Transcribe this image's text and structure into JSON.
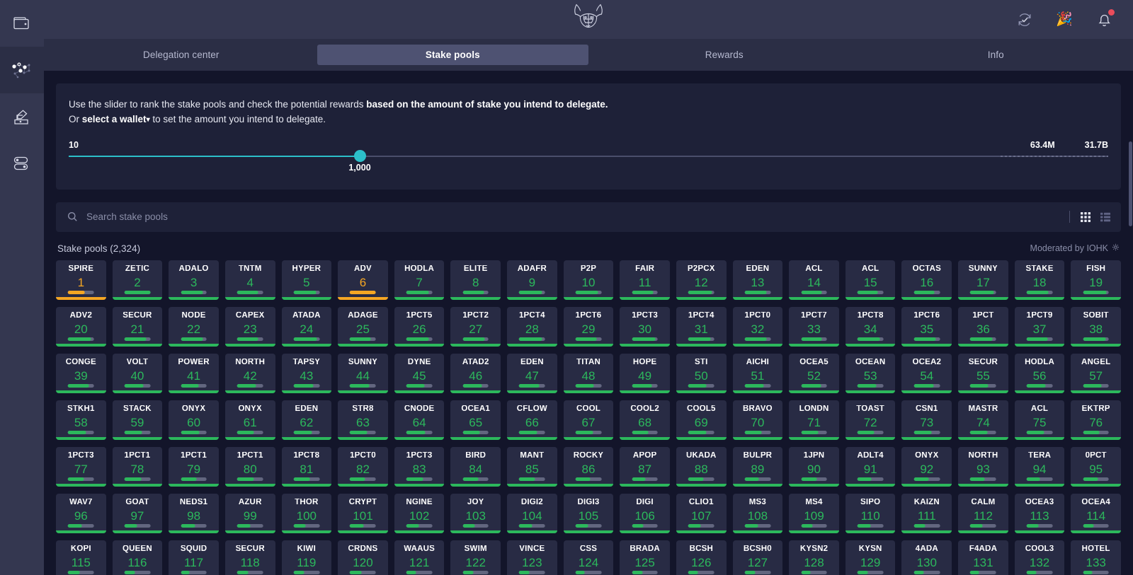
{
  "sidebar": {
    "items": [
      {
        "name": "wallet",
        "icon": "wallet-icon",
        "selected": false
      },
      {
        "name": "delegation",
        "icon": "network-nodes-icon",
        "selected": true
      },
      {
        "name": "voting",
        "icon": "ballot-box-icon",
        "selected": false
      },
      {
        "name": "settings",
        "icon": "toggles-icon",
        "selected": false
      }
    ]
  },
  "topbar": {
    "logo": "bull-head-logo",
    "icons": [
      {
        "name": "sync-status-icon",
        "glyph": "check-circle-arrows"
      },
      {
        "name": "celebration-icon",
        "glyph": "🎉"
      },
      {
        "name": "notifications-bell-icon",
        "glyph": "bell",
        "badge": true
      }
    ]
  },
  "tabs": [
    {
      "label": "Delegation center",
      "active": false
    },
    {
      "label": "Stake pools",
      "active": true
    },
    {
      "label": "Rewards",
      "active": false
    },
    {
      "label": "Info",
      "active": false
    }
  ],
  "slider_card": {
    "line1_pre": "Use the slider to rank the stake pools and check the potential rewards ",
    "line1_bold": "based on the amount of stake you intend to delegate.",
    "line2_pre": "Or ",
    "line2_link": "select a wallet",
    "line2_caret": "⌄",
    "line2_post": " to set the amount you intend to delegate.",
    "min_label": "10",
    "value_label": "1,000",
    "mid_label": "63.4M",
    "max_label": "31.7B",
    "fill_percent": 28
  },
  "search": {
    "placeholder": "Search stake pools",
    "value": "",
    "icon": "search-icon",
    "grid_view_icon": "grid-view-icon",
    "list_view_icon": "list-view-icon",
    "active_view": "grid"
  },
  "pools_header": {
    "title": "Stake pools (2,324)",
    "moderated": "Moderated by IOHK",
    "moderated_icon": "gear-icon"
  },
  "colors": {
    "rank_green": "#2cb85c",
    "rank_orange": "#f5a623",
    "slider_accent": "#2cbfc9",
    "badge_red": "#ea4c5b",
    "tile_bg": "#282b44",
    "card_bg": "#1e2138",
    "page_bg": "#13152a",
    "chrome_bg": "#343750"
  },
  "pools": [
    {
      "ticker": "SPIRE",
      "rank": 1,
      "status": "warn",
      "sat": 64
    },
    {
      "ticker": "ZETIC",
      "rank": 2,
      "status": "ok",
      "sat": 100
    },
    {
      "ticker": "ADALO",
      "rank": 3,
      "status": "ok",
      "sat": 86
    },
    {
      "ticker": "TNTM",
      "rank": 4,
      "status": "ok",
      "sat": 82
    },
    {
      "ticker": "HYPER",
      "rank": 5,
      "status": "ok",
      "sat": 88
    },
    {
      "ticker": "ADV",
      "rank": 6,
      "status": "warn",
      "sat": 100
    },
    {
      "ticker": "HODLA",
      "rank": 7,
      "status": "ok",
      "sat": 88
    },
    {
      "ticker": "ELITE",
      "rank": 8,
      "status": "ok",
      "sat": 82
    },
    {
      "ticker": "ADAFR",
      "rank": 9,
      "status": "ok",
      "sat": 90
    },
    {
      "ticker": "P2P",
      "rank": 10,
      "status": "ok",
      "sat": 86
    },
    {
      "ticker": "FAIR",
      "rank": 11,
      "status": "ok",
      "sat": 84
    },
    {
      "ticker": "P2PCX",
      "rank": 12,
      "status": "ok",
      "sat": 92
    },
    {
      "ticker": "EDEN",
      "rank": 13,
      "status": "ok",
      "sat": 84
    },
    {
      "ticker": "ACL",
      "rank": 14,
      "status": "ok",
      "sat": 80
    },
    {
      "ticker": "ACL",
      "rank": 15,
      "status": "ok",
      "sat": 78
    },
    {
      "ticker": "OCTAS",
      "rank": 16,
      "status": "ok",
      "sat": 80
    },
    {
      "ticker": "SUNNY",
      "rank": 17,
      "status": "ok",
      "sat": 92
    },
    {
      "ticker": "STAKE",
      "rank": 18,
      "status": "ok",
      "sat": 84
    },
    {
      "ticker": "FISH",
      "rank": 19,
      "status": "ok",
      "sat": 90
    },
    {
      "ticker": "ADV2",
      "rank": 20,
      "status": "ok",
      "sat": 88
    },
    {
      "ticker": "SECUR",
      "rank": 21,
      "status": "ok",
      "sat": 84
    },
    {
      "ticker": "NODE",
      "rank": 22,
      "status": "ok",
      "sat": 86
    },
    {
      "ticker": "CAPEX",
      "rank": 23,
      "status": "ok",
      "sat": 82
    },
    {
      "ticker": "ATADA",
      "rank": 24,
      "status": "ok",
      "sat": 90
    },
    {
      "ticker": "ADAGE",
      "rank": 25,
      "status": "ok",
      "sat": 80
    },
    {
      "ticker": "1PCT5",
      "rank": 26,
      "status": "ok",
      "sat": 86
    },
    {
      "ticker": "1PCT2",
      "rank": 27,
      "status": "ok",
      "sat": 84
    },
    {
      "ticker": "1PCT4",
      "rank": 28,
      "status": "ok",
      "sat": 88
    },
    {
      "ticker": "1PCT6",
      "rank": 29,
      "status": "ok",
      "sat": 82
    },
    {
      "ticker": "1PCT3",
      "rank": 30,
      "status": "ok",
      "sat": 90
    },
    {
      "ticker": "1PCT4",
      "rank": 31,
      "status": "ok",
      "sat": 86
    },
    {
      "ticker": "1PCT0",
      "rank": 32,
      "status": "ok",
      "sat": 84
    },
    {
      "ticker": "1PCT7",
      "rank": 33,
      "status": "ok",
      "sat": 80
    },
    {
      "ticker": "1PCT8",
      "rank": 34,
      "status": "ok",
      "sat": 88
    },
    {
      "ticker": "1PCT6",
      "rank": 35,
      "status": "ok",
      "sat": 84
    },
    {
      "ticker": "1PCT",
      "rank": 36,
      "status": "ok",
      "sat": 86
    },
    {
      "ticker": "1PCT9",
      "rank": 37,
      "status": "ok",
      "sat": 82
    },
    {
      "ticker": "SOBIT",
      "rank": 38,
      "status": "ok",
      "sat": 88
    },
    {
      "ticker": "CONGE",
      "rank": 39,
      "status": "ok",
      "sat": 80
    },
    {
      "ticker": "VOLT",
      "rank": 40,
      "status": "ok",
      "sat": 74
    },
    {
      "ticker": "POWER",
      "rank": 41,
      "status": "ok",
      "sat": 68
    },
    {
      "ticker": "NORTH",
      "rank": 42,
      "status": "ok",
      "sat": 72
    },
    {
      "ticker": "TAPSY",
      "rank": 43,
      "status": "ok",
      "sat": 78
    },
    {
      "ticker": "SUNNY",
      "rank": 44,
      "status": "ok",
      "sat": 76
    },
    {
      "ticker": "DYNE",
      "rank": 45,
      "status": "ok",
      "sat": 70
    },
    {
      "ticker": "ATAD2",
      "rank": 46,
      "status": "ok",
      "sat": 74
    },
    {
      "ticker": "EDEN",
      "rank": 47,
      "status": "ok",
      "sat": 78
    },
    {
      "ticker": "TITAN",
      "rank": 48,
      "status": "ok",
      "sat": 72
    },
    {
      "ticker": "HOPE",
      "rank": 49,
      "status": "ok",
      "sat": 76
    },
    {
      "ticker": "STI",
      "rank": 50,
      "status": "ok",
      "sat": 70
    },
    {
      "ticker": "AICHI",
      "rank": 51,
      "status": "ok",
      "sat": 74
    },
    {
      "ticker": "OCEA5",
      "rank": 52,
      "status": "ok",
      "sat": 78
    },
    {
      "ticker": "OCEAN",
      "rank": 53,
      "status": "ok",
      "sat": 72
    },
    {
      "ticker": "OCEA2",
      "rank": 54,
      "status": "ok",
      "sat": 76
    },
    {
      "ticker": "SECUR",
      "rank": 55,
      "status": "ok",
      "sat": 70
    },
    {
      "ticker": "HODLA",
      "rank": 56,
      "status": "ok",
      "sat": 74
    },
    {
      "ticker": "ANGEL",
      "rank": 57,
      "status": "ok",
      "sat": 72
    },
    {
      "ticker": "STKH1",
      "rank": 58,
      "status": "ok",
      "sat": 70
    },
    {
      "ticker": "STACK",
      "rank": 59,
      "status": "ok",
      "sat": 68
    },
    {
      "ticker": "ONYX",
      "rank": 60,
      "status": "ok",
      "sat": 72
    },
    {
      "ticker": "ONYX",
      "rank": 61,
      "status": "ok",
      "sat": 66
    },
    {
      "ticker": "EDEN",
      "rank": 62,
      "status": "ok",
      "sat": 70
    },
    {
      "ticker": "STR8",
      "rank": 63,
      "status": "ok",
      "sat": 68
    },
    {
      "ticker": "CNODE",
      "rank": 64,
      "status": "ok",
      "sat": 72
    },
    {
      "ticker": "OCEA1",
      "rank": 65,
      "status": "ok",
      "sat": 66
    },
    {
      "ticker": "CFLOW",
      "rank": 66,
      "status": "ok",
      "sat": 70
    },
    {
      "ticker": "COOL",
      "rank": 67,
      "status": "ok",
      "sat": 68
    },
    {
      "ticker": "COOL2",
      "rank": 68,
      "status": "ok",
      "sat": 64
    },
    {
      "ticker": "COOL5",
      "rank": 69,
      "status": "ok",
      "sat": 70
    },
    {
      "ticker": "BRAVO",
      "rank": 70,
      "status": "ok",
      "sat": 66
    },
    {
      "ticker": "LONDN",
      "rank": 71,
      "status": "ok",
      "sat": 68
    },
    {
      "ticker": "TOAST",
      "rank": 72,
      "status": "ok",
      "sat": 64
    },
    {
      "ticker": "CSN1",
      "rank": 73,
      "status": "ok",
      "sat": 70
    },
    {
      "ticker": "MASTR",
      "rank": 74,
      "status": "ok",
      "sat": 66
    },
    {
      "ticker": "ACL",
      "rank": 75,
      "status": "ok",
      "sat": 68
    },
    {
      "ticker": "EKTRP",
      "rank": 76,
      "status": "ok",
      "sat": 64
    },
    {
      "ticker": "1PCT3",
      "rank": 77,
      "status": "ok",
      "sat": 62
    },
    {
      "ticker": "1PCT1",
      "rank": 78,
      "status": "ok",
      "sat": 66
    },
    {
      "ticker": "1PCT1",
      "rank": 79,
      "status": "ok",
      "sat": 60
    },
    {
      "ticker": "1PCT1",
      "rank": 80,
      "status": "ok",
      "sat": 64
    },
    {
      "ticker": "1PCT8",
      "rank": 81,
      "status": "ok",
      "sat": 62
    },
    {
      "ticker": "1PCT0",
      "rank": 82,
      "status": "ok",
      "sat": 58
    },
    {
      "ticker": "1PCT3",
      "rank": 83,
      "status": "ok",
      "sat": 64
    },
    {
      "ticker": "BIRD",
      "rank": 84,
      "status": "ok",
      "sat": 60
    },
    {
      "ticker": "MANT",
      "rank": 85,
      "status": "ok",
      "sat": 62
    },
    {
      "ticker": "ROCKY",
      "rank": 86,
      "status": "ok",
      "sat": 58
    },
    {
      "ticker": "APOP",
      "rank": 87,
      "status": "ok",
      "sat": 54
    },
    {
      "ticker": "UKADA",
      "rank": 88,
      "status": "ok",
      "sat": 58
    },
    {
      "ticker": "BULPR",
      "rank": 89,
      "status": "ok",
      "sat": 56
    },
    {
      "ticker": "1JPN",
      "rank": 90,
      "status": "ok",
      "sat": 60
    },
    {
      "ticker": "ADLT4",
      "rank": 91,
      "status": "ok",
      "sat": 54
    },
    {
      "ticker": "ONYX",
      "rank": 92,
      "status": "ok",
      "sat": 58
    },
    {
      "ticker": "NORTH",
      "rank": 93,
      "status": "ok",
      "sat": 56
    },
    {
      "ticker": "TERA",
      "rank": 94,
      "status": "ok",
      "sat": 52
    },
    {
      "ticker": "0PCT",
      "rank": 95,
      "status": "ok",
      "sat": 58
    },
    {
      "ticker": "WAV7",
      "rank": 96,
      "status": "ok",
      "sat": 54
    },
    {
      "ticker": "GOAT",
      "rank": 97,
      "status": "ok",
      "sat": 50
    },
    {
      "ticker": "NEDS1",
      "rank": 98,
      "status": "ok",
      "sat": 56
    },
    {
      "ticker": "AZUR",
      "rank": 99,
      "status": "ok",
      "sat": 52
    },
    {
      "ticker": "THOR",
      "rank": 100,
      "status": "ok",
      "sat": 48
    },
    {
      "ticker": "CRYPT",
      "rank": 101,
      "status": "ok",
      "sat": 54
    },
    {
      "ticker": "NGINE",
      "rank": 102,
      "status": "ok",
      "sat": 50
    },
    {
      "ticker": "JOY",
      "rank": 103,
      "status": "ok",
      "sat": 46
    },
    {
      "ticker": "DIGI2",
      "rank": 104,
      "status": "ok",
      "sat": 52
    },
    {
      "ticker": "DIGI3",
      "rank": 105,
      "status": "ok",
      "sat": 48
    },
    {
      "ticker": "DIGI",
      "rank": 106,
      "status": "ok",
      "sat": 44
    },
    {
      "ticker": "CLIO1",
      "rank": 107,
      "status": "ok",
      "sat": 48
    },
    {
      "ticker": "MS3",
      "rank": 108,
      "status": "ok",
      "sat": 52
    },
    {
      "ticker": "MS4",
      "rank": 109,
      "status": "ok",
      "sat": 46
    },
    {
      "ticker": "SIPO",
      "rank": 110,
      "status": "ok",
      "sat": 50
    },
    {
      "ticker": "KAIZN",
      "rank": 111,
      "status": "ok",
      "sat": 44
    },
    {
      "ticker": "CALM",
      "rank": 112,
      "status": "ok",
      "sat": 48
    },
    {
      "ticker": "OCEA3",
      "rank": 113,
      "status": "ok",
      "sat": 46
    },
    {
      "ticker": "OCEA4",
      "rank": 114,
      "status": "ok",
      "sat": 42
    },
    {
      "ticker": "KOPI",
      "rank": 115,
      "status": "ok",
      "sat": 46
    },
    {
      "ticker": "QUEEN",
      "rank": 116,
      "status": "ok",
      "sat": 42
    },
    {
      "ticker": "SQUID",
      "rank": 117,
      "status": "ok",
      "sat": 34
    },
    {
      "ticker": "SECUR",
      "rank": 118,
      "status": "ok",
      "sat": 44
    },
    {
      "ticker": "KIWI",
      "rank": 119,
      "status": "ok",
      "sat": 40
    },
    {
      "ticker": "CRDNS",
      "rank": 120,
      "status": "ok",
      "sat": 44
    },
    {
      "ticker": "WAAUS",
      "rank": 121,
      "status": "ok",
      "sat": 38
    },
    {
      "ticker": "SWIM",
      "rank": 122,
      "status": "ok",
      "sat": 42
    },
    {
      "ticker": "VINCE",
      "rank": 123,
      "status": "ok",
      "sat": 40
    },
    {
      "ticker": "CSS",
      "rank": 124,
      "status": "ok",
      "sat": 36
    },
    {
      "ticker": "BRADA",
      "rank": 125,
      "status": "ok",
      "sat": 42
    },
    {
      "ticker": "BCSH",
      "rank": 126,
      "status": "ok",
      "sat": 38
    },
    {
      "ticker": "BCSH0",
      "rank": 127,
      "status": "ok",
      "sat": 40
    },
    {
      "ticker": "KYSN2",
      "rank": 128,
      "status": "ok",
      "sat": 36
    },
    {
      "ticker": "KYSN",
      "rank": 129,
      "status": "ok",
      "sat": 40
    },
    {
      "ticker": "4ADA",
      "rank": 130,
      "status": "ok",
      "sat": 38
    },
    {
      "ticker": "F4ADA",
      "rank": 131,
      "status": "ok",
      "sat": 34
    },
    {
      "ticker": "COOL3",
      "rank": 132,
      "status": "ok",
      "sat": 38
    },
    {
      "ticker": "HOTEL",
      "rank": 133,
      "status": "ok",
      "sat": 36
    }
  ]
}
